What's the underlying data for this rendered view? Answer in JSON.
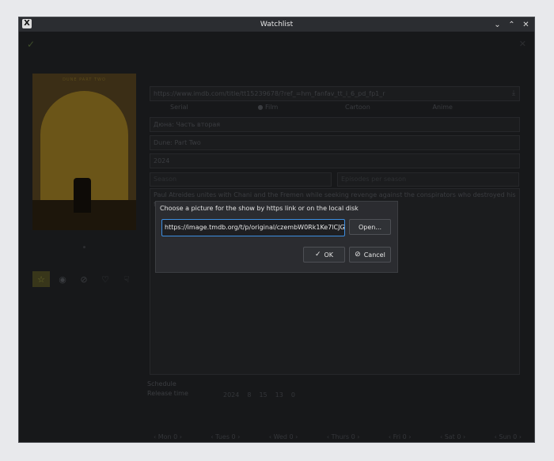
{
  "window": {
    "title": "Watchlist",
    "app_icon": "X",
    "controls": {
      "minimize": "⌄",
      "maximize": "⌃",
      "close": "✕"
    }
  },
  "background_form": {
    "imdb_url": "https://www.imdb.com/title/tt15239678/?ref_=hm_fanfav_tt_i_6_pd_fp1_r",
    "show_types": [
      "Serial",
      "Film",
      "Cartoon",
      "Anime"
    ],
    "selected_type": "Film",
    "title_ru": "Дюна: Часть вторая",
    "title_en": "Dune: Part Two",
    "year": "2024",
    "season_placeholder": "Season",
    "episode_placeholder": "Episodes per season",
    "description": "Paul Atreides unites with Chani and the Fremen while seeking revenge against the conspirators who destroyed his family.",
    "schedule_label": "Schedule",
    "release_time_label": "Release time",
    "release_fields": [
      "2024",
      "8",
      "15",
      "13",
      "0"
    ],
    "days": [
      {
        "label": "Mon 0"
      },
      {
        "label": "Tues 0"
      },
      {
        "label": "Wed 0"
      },
      {
        "label": "Thurs 0"
      },
      {
        "label": "Fri 0"
      },
      {
        "label": "Sat 0"
      },
      {
        "label": "Sun 0"
      }
    ],
    "poster_text": "DUNE PART TWO"
  },
  "dialog": {
    "label": "Choose a picture for the show by https link or on the local disk",
    "url_value": "https://image.tmdb.org/t/p/original/czembW0Rk1Ke7lCJG",
    "open_label": "Open...",
    "ok_label": "OK",
    "cancel_label": "Cancel"
  },
  "colors": {
    "accent": "#3d8ee0",
    "dialog_bg": "#2b2c30",
    "window_bg": "#17181a"
  }
}
